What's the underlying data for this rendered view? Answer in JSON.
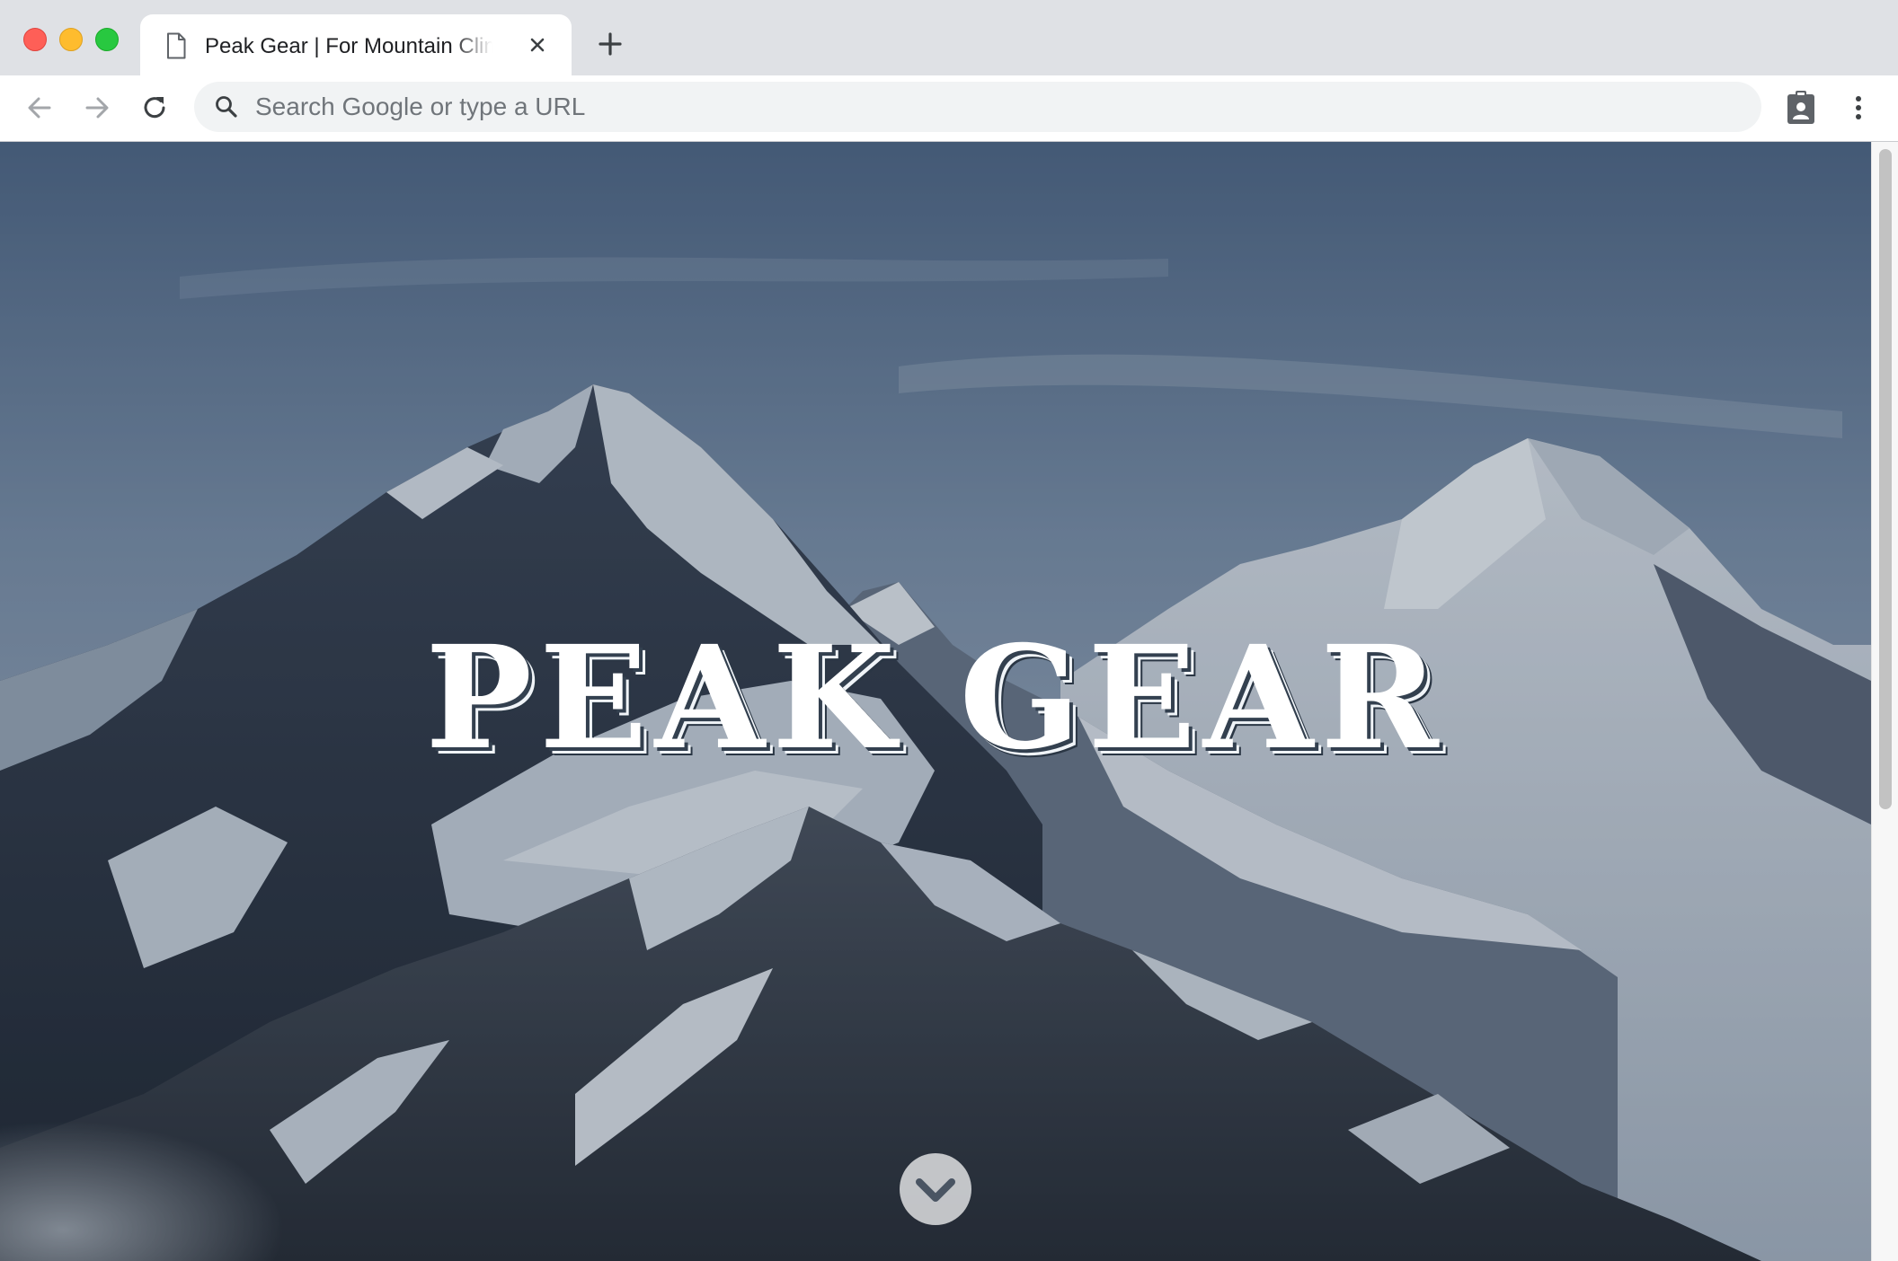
{
  "window": {
    "traffic_lights": [
      "close",
      "minimize",
      "maximize"
    ]
  },
  "tab": {
    "title": "Peak Gear | For Mountain Climbers",
    "icon": "file-icon",
    "close_icon": "close-icon"
  },
  "toolbar": {
    "new_tab_icon": "plus-icon",
    "back_icon": "arrow-left-icon",
    "forward_icon": "arrow-right-icon",
    "reload_icon": "reload-icon",
    "search_icon": "search-icon",
    "profile_icon": "profile-badge-icon",
    "menu_icon": "kebab-menu-icon"
  },
  "omnibox": {
    "placeholder": "Search Google or type a URL",
    "value": ""
  },
  "hero": {
    "title": "PEAK GEAR",
    "scroll_icon": "chevron-down-icon"
  },
  "colors": {
    "tab_strip": "#dfe1e5",
    "omnibox_bg": "#f1f3f4",
    "close_red": "#fe5f57",
    "minimize_yellow": "#febc2e",
    "maximize_green": "#28c840"
  }
}
